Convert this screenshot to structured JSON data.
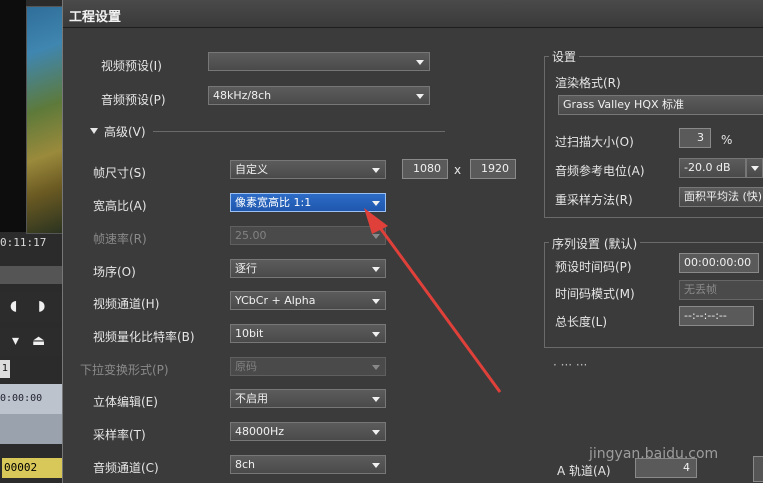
{
  "background_app": {
    "timecode": "0:11:17",
    "track_number": "1",
    "track_time": "0:00:00",
    "clip_label": "00002"
  },
  "dialog": {
    "title": "工程设置",
    "left": {
      "video_preset": {
        "label": "视频预设(I)",
        "value": ""
      },
      "audio_preset": {
        "label": "音频预设(P)",
        "value": "48kHz/8ch"
      },
      "advanced_label": "高级(V)",
      "frame_size": {
        "label": "帧尺寸(S)",
        "value": "自定义",
        "width": "1080",
        "sep": "x",
        "height": "1920"
      },
      "aspect_ratio": {
        "label": "宽高比(A)",
        "value": "像素宽高比 1:1"
      },
      "frame_rate": {
        "label": "帧速率(R)",
        "value": "25.00"
      },
      "field_order": {
        "label": "场序(O)",
        "value": "逐行"
      },
      "video_channel": {
        "label": "视频通道(H)",
        "value": "YCbCr + Alpha"
      },
      "video_quant": {
        "label": "视频量化比特率(B)",
        "value": "10bit"
      },
      "pulldown": {
        "label": "下拉变换形式(P)",
        "value": "原码"
      },
      "stereo_edit": {
        "label": "立体编辑(E)",
        "value": "不启用"
      },
      "sample_rate": {
        "label": "采样率(T)",
        "value": "48000Hz"
      },
      "audio_channel": {
        "label": "音频通道(C)",
        "value": "8ch"
      }
    },
    "settings_group": {
      "title": "设置",
      "render_format_label": "渲染格式(R)",
      "render_format_value": "Grass Valley HQX 标准",
      "overscan_label": "过扫描大小(O)",
      "overscan_value": "3",
      "overscan_unit": "%",
      "audio_ref_label": "音频参考电位(A)",
      "audio_ref_value": "-20.0 dB",
      "resample_label": "重采样方法(R)",
      "resample_value": "面积平均法 (快)"
    },
    "sequence_group": {
      "title": "序列设置 (默认)",
      "preset_tc_label": "预设时间码(P)",
      "preset_tc_value": "00:00:00:00",
      "tc_mode_label": "时间码模式(M)",
      "tc_mode_value": "无丢帧",
      "total_length_label": "总长度(L)",
      "total_length_value": "--:--:--:--",
      "dots": "· ··· ···",
      "a_track_label": "A 轨道(A)",
      "a_track_value": "4",
      "watermark": "jingyan.baidu.com"
    }
  },
  "colors": {
    "annotation_arrow": "#e0403a",
    "selected": "#2d6cc7"
  }
}
